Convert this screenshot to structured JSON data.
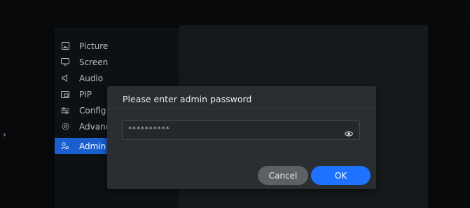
{
  "menu": {
    "items": [
      {
        "label": "Picture",
        "icon": "picture-icon"
      },
      {
        "label": "Screen",
        "icon": "screen-icon"
      },
      {
        "label": "Audio",
        "icon": "audio-icon"
      },
      {
        "label": "PIP",
        "icon": "pip-icon"
      },
      {
        "label": "Config",
        "icon": "config-icon"
      },
      {
        "label": "Advanc",
        "icon": "advanced-icon"
      },
      {
        "label": "Admin",
        "icon": "admin-icon",
        "active": true
      }
    ]
  },
  "side_arrow": "›",
  "dialog": {
    "title": "Please enter admin password",
    "password_value": "**********",
    "cancel_label": "Cancel",
    "ok_label": "OK"
  },
  "colors": {
    "accent": "#1f72ff",
    "active_menu": "#1a5fcf",
    "dialog_bg": "#2a2e31"
  }
}
